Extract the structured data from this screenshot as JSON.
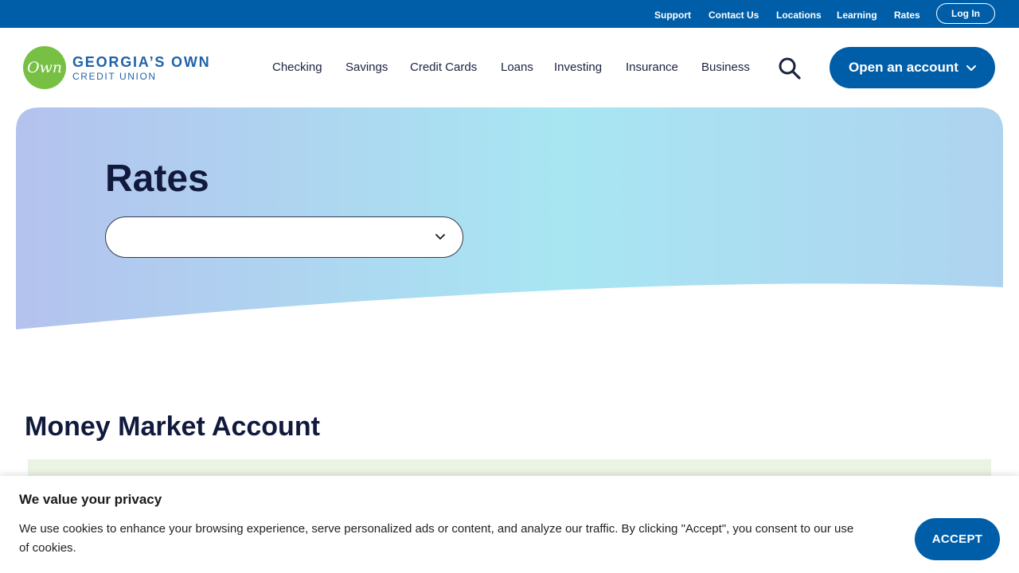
{
  "utility_nav": {
    "support": "Support",
    "contact_us": "Contact Us",
    "locations": "Locations",
    "learning": "Learning",
    "rates": "Rates",
    "log_in": "Log In"
  },
  "logo": {
    "badge": "Own",
    "line1": "GEORGIA’S OWN",
    "line2": "CREDIT UNION"
  },
  "main_nav": {
    "checking": "Checking",
    "savings": "Savings",
    "credit_cards": "Credit Cards",
    "loans": "Loans",
    "investing": "Investing",
    "insurance": "Insurance",
    "business": "Business",
    "open_account": "Open an account"
  },
  "hero": {
    "title": "Rates",
    "select_value": ""
  },
  "section": {
    "title": "Money Market Account"
  },
  "cookie": {
    "title": "We value your privacy",
    "text": "We use cookies to enhance your browsing experience, serve personalized ads or content, and analyze our traffic. By clicking \"Accept\", you consent to our use of cookies.",
    "accept": "ACCEPT"
  },
  "colors": {
    "brand_blue": "#005ea8",
    "brand_green": "#77c043",
    "heading": "#111a3d"
  }
}
